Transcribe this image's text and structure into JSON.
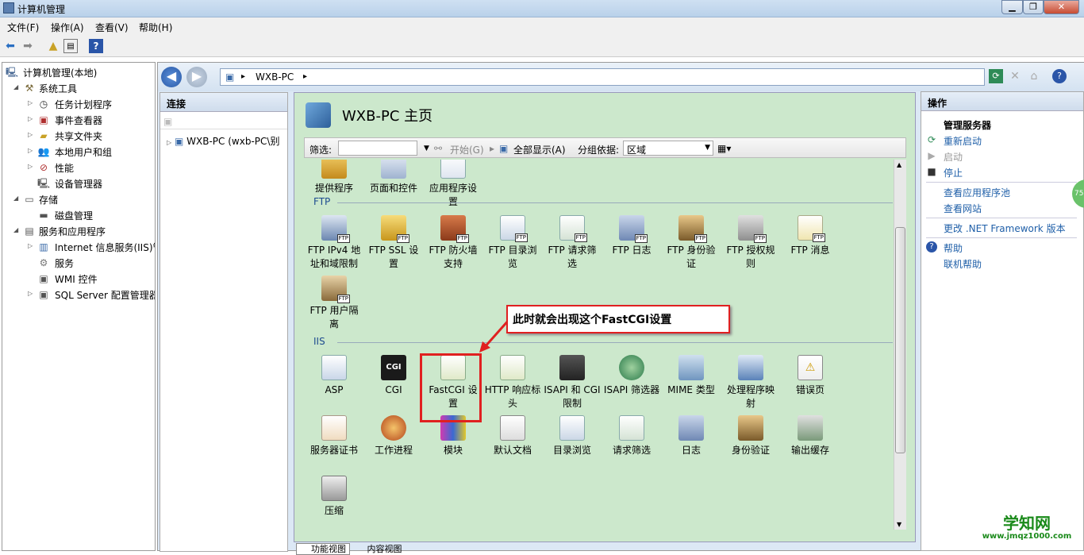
{
  "window": {
    "title": "计算机管理"
  },
  "menu": [
    "文件(F)",
    "操作(A)",
    "查看(V)",
    "帮助(H)"
  ],
  "tree": [
    {
      "label": "计算机管理(本地)",
      "level": 0
    },
    {
      "label": "系统工具",
      "level": 1
    },
    {
      "label": "任务计划程序",
      "level": 2
    },
    {
      "label": "事件查看器",
      "level": 2
    },
    {
      "label": "共享文件夹",
      "level": 2
    },
    {
      "label": "本地用户和组",
      "level": 2
    },
    {
      "label": "性能",
      "level": 2
    },
    {
      "label": "设备管理器",
      "level": 2
    },
    {
      "label": "存储",
      "level": 1
    },
    {
      "label": "磁盘管理",
      "level": 2
    },
    {
      "label": "服务和应用程序",
      "level": 1
    },
    {
      "label": "Internet 信息服务(IIS)管",
      "level": 2
    },
    {
      "label": "服务",
      "level": 2
    },
    {
      "label": "WMI 控件",
      "level": 2
    },
    {
      "label": "SQL Server 配置管理器",
      "level": 2
    }
  ],
  "address": {
    "path": "WXB-PC",
    "sep": "▸"
  },
  "connections": {
    "header": "连接",
    "node": "WXB-PC (wxb-PC\\别"
  },
  "page": {
    "title": "WXB-PC 主页"
  },
  "filter": {
    "label": "筛选:",
    "start": "开始(G)",
    "showall": "全部显示(A)",
    "groupby": "分组依据:",
    "group_value": "区域"
  },
  "sections": {
    "ftp": "FTP",
    "iis": "IIS"
  },
  "top_items": [
    {
      "l1": "提供程序",
      "l2": ""
    },
    {
      "l1": "页面和控件",
      "l2": ""
    },
    {
      "l1": "应用程序设",
      "l2": "置"
    }
  ],
  "ftp_items": [
    {
      "l1": "FTP IPv4 地",
      "l2": "址和域限制"
    },
    {
      "l1": "FTP SSL 设",
      "l2": "置"
    },
    {
      "l1": "FTP 防火墙",
      "l2": "支持"
    },
    {
      "l1": "FTP 目录浏",
      "l2": "览"
    },
    {
      "l1": "FTP 请求筛",
      "l2": "选"
    },
    {
      "l1": "FTP 日志",
      "l2": ""
    },
    {
      "l1": "FTP 身份验",
      "l2": "证"
    },
    {
      "l1": "FTP 授权规",
      "l2": "则"
    },
    {
      "l1": "FTP 消息",
      "l2": ""
    },
    {
      "l1": "FTP 用户隔",
      "l2": "离"
    }
  ],
  "iis_items": [
    {
      "l1": "ASP",
      "l2": ""
    },
    {
      "l1": "CGI",
      "l2": ""
    },
    {
      "l1": "FastCGI 设",
      "l2": "置"
    },
    {
      "l1": "HTTP 响应标",
      "l2": "头"
    },
    {
      "l1": "ISAPI 和 CGI",
      "l2": "限制"
    },
    {
      "l1": "ISAPI 筛选器",
      "l2": ""
    },
    {
      "l1": "MIME 类型",
      "l2": ""
    },
    {
      "l1": "处理程序映",
      "l2": "射"
    },
    {
      "l1": "错误页",
      "l2": ""
    },
    {
      "l1": "服务器证书",
      "l2": ""
    },
    {
      "l1": "工作进程",
      "l2": ""
    },
    {
      "l1": "模块",
      "l2": ""
    },
    {
      "l1": "默认文档",
      "l2": ""
    },
    {
      "l1": "目录浏览",
      "l2": ""
    },
    {
      "l1": "请求筛选",
      "l2": ""
    },
    {
      "l1": "日志",
      "l2": ""
    },
    {
      "l1": "身份验证",
      "l2": ""
    },
    {
      "l1": "输出缓存",
      "l2": ""
    },
    {
      "l1": "压缩",
      "l2": ""
    }
  ],
  "callout": "此时就会出现这个FastCGI设置",
  "actions": {
    "header": "操作",
    "group": "管理服务器",
    "restart": "重新启动",
    "start": "启动",
    "stop": "停止",
    "view_pools": "查看应用程序池",
    "view_sites": "查看网站",
    "change_net": "更改 .NET Framework 版本",
    "help": "帮助",
    "online_help": "联机帮助"
  },
  "bottom_tabs": {
    "feature": "功能视图",
    "content": "内容视图"
  },
  "watermark": {
    "line1": "学知网",
    "line2": "www.jmqz1000.com"
  },
  "badge": "75"
}
